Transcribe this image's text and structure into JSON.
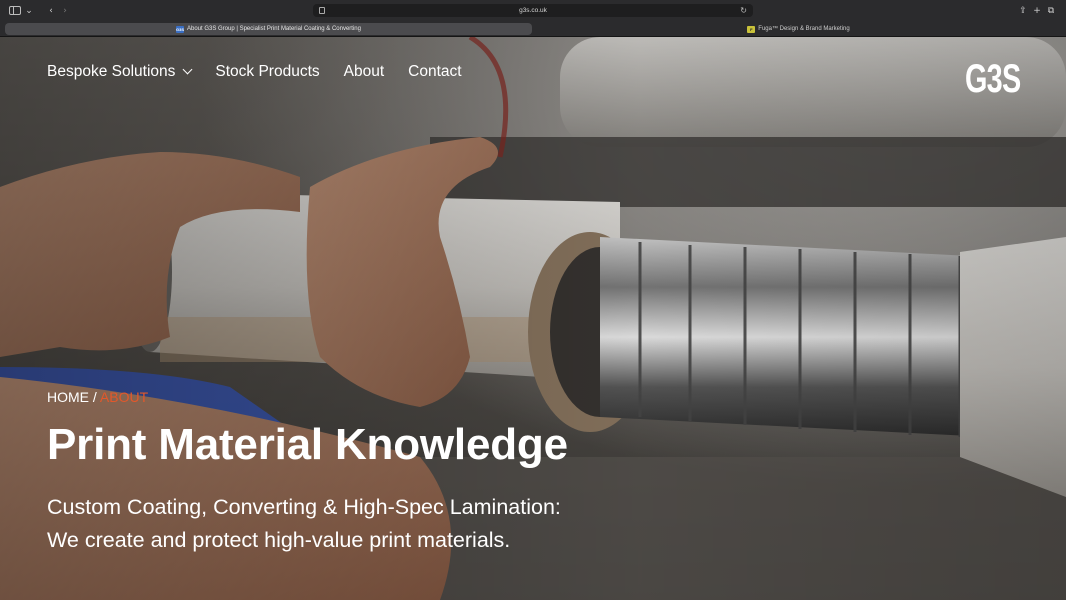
{
  "browser": {
    "url": "g3s.co.uk",
    "tabs": [
      {
        "label": "About G3S Group | Specialist Print Material Coating & Converting",
        "favicon": "G3S",
        "active": true
      },
      {
        "label": "Fuga™ Design & Brand Marketing",
        "favicon": "F",
        "active": false
      }
    ]
  },
  "nav": {
    "items": [
      "Bespoke Solutions",
      "Stock Products",
      "About",
      "Contact"
    ],
    "logo": "G3S"
  },
  "breadcrumb": {
    "home": "HOME",
    "separator": "/",
    "current": "ABOUT"
  },
  "hero": {
    "title": "Print Material Knowledge",
    "subtitle_line1": "Custom Coating, Converting & High-Spec Lamination:",
    "subtitle_line2": "We create and protect high-value print materials."
  },
  "colors": {
    "accent": "#e2582b",
    "text": "#ffffff"
  }
}
